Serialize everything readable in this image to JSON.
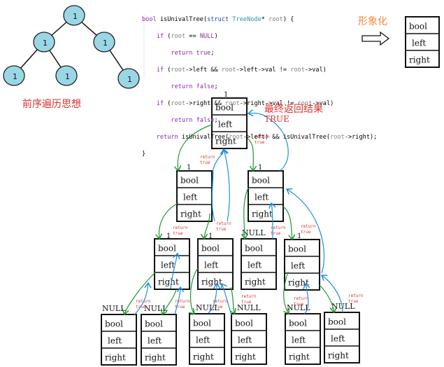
{
  "tree": {
    "node_value": "1",
    "node_fill": "#9ad7e6",
    "caption": "前序遍历思想"
  },
  "code": {
    "lines": [
      "bool isUnivalTree(struct TreeNode* root) {",
      "    if (root == NULL)",
      "        return true;",
      "    if (root->left && root->left->val != root->val)",
      "        return false;",
      "    if (root->right && root->right->val != root->val)",
      "        return false;",
      "    return isUnivalTree(root->left) && isUnivalTree(root->right);",
      "}"
    ]
  },
  "visualize": {
    "label": "形象化",
    "arrow_icon": "right-arrow-icon"
  },
  "struct_fields": [
    "bool",
    "left",
    "right"
  ],
  "result": {
    "title": "最终返回结果",
    "value": "TRUE"
  },
  "labels": {
    "one": "1",
    "null": "NULL",
    "return_true": [
      "return",
      "true"
    ]
  },
  "colors": {
    "call_arrow": "#1a9a2a",
    "return_arrow": "#1a8fe0",
    "annotation": "#e03030",
    "caption": "#e03030"
  }
}
